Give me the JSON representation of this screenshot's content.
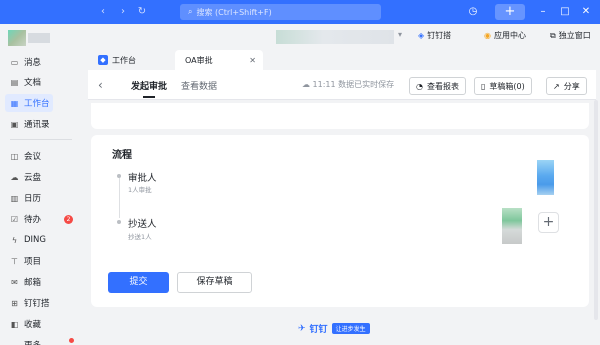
{
  "titlebar": {
    "search_placeholder": "搜索 (Ctrl+Shift+F)",
    "history_icon": "clock-icon",
    "add_label": "+",
    "accent": "#3370ff"
  },
  "sidebar": {
    "items": [
      {
        "label": "消息",
        "icon": "chat-icon"
      },
      {
        "label": "文档",
        "icon": "doc-icon"
      },
      {
        "label": "工作台",
        "icon": "grid-icon"
      },
      {
        "label": "通讯录",
        "icon": "contacts-icon"
      },
      {
        "label": "会议",
        "icon": "video-icon"
      },
      {
        "label": "云盘",
        "icon": "cloud-icon"
      },
      {
        "label": "日历",
        "icon": "calendar-icon"
      },
      {
        "label": "待办",
        "icon": "todo-icon"
      },
      {
        "label": "DING",
        "icon": "ding-icon"
      },
      {
        "label": "项目",
        "icon": "project-icon"
      },
      {
        "label": "邮箱",
        "icon": "mail-icon"
      },
      {
        "label": "钉钉搭",
        "icon": "build-icon"
      },
      {
        "label": "收藏",
        "icon": "favorite-icon"
      },
      {
        "label": "更多",
        "icon": "more-icon"
      }
    ],
    "todo_badge": "2"
  },
  "header": {
    "dingda_label": "钉钉搭",
    "appcenter_label": "应用中心",
    "standalone_label": "独立窗口"
  },
  "tabs": [
    {
      "label": "工作台"
    },
    {
      "label": "OA审批"
    }
  ],
  "app": {
    "tab_initiate": "发起审批",
    "tab_view_data": "查看数据",
    "save_status": "11:11 数据已实时保存",
    "view_report": "查看报表",
    "draft_box": "草稿箱(0)",
    "share": "分享"
  },
  "flow": {
    "title": "流程",
    "approver_label": "审批人",
    "approver_sub": "1人审批",
    "cc_label": "抄送人",
    "cc_sub": "抄送1人"
  },
  "actions": {
    "submit": "提交",
    "save_draft": "保存草稿"
  },
  "footer": {
    "brand": "钉钉",
    "tag": "让进步发生"
  }
}
